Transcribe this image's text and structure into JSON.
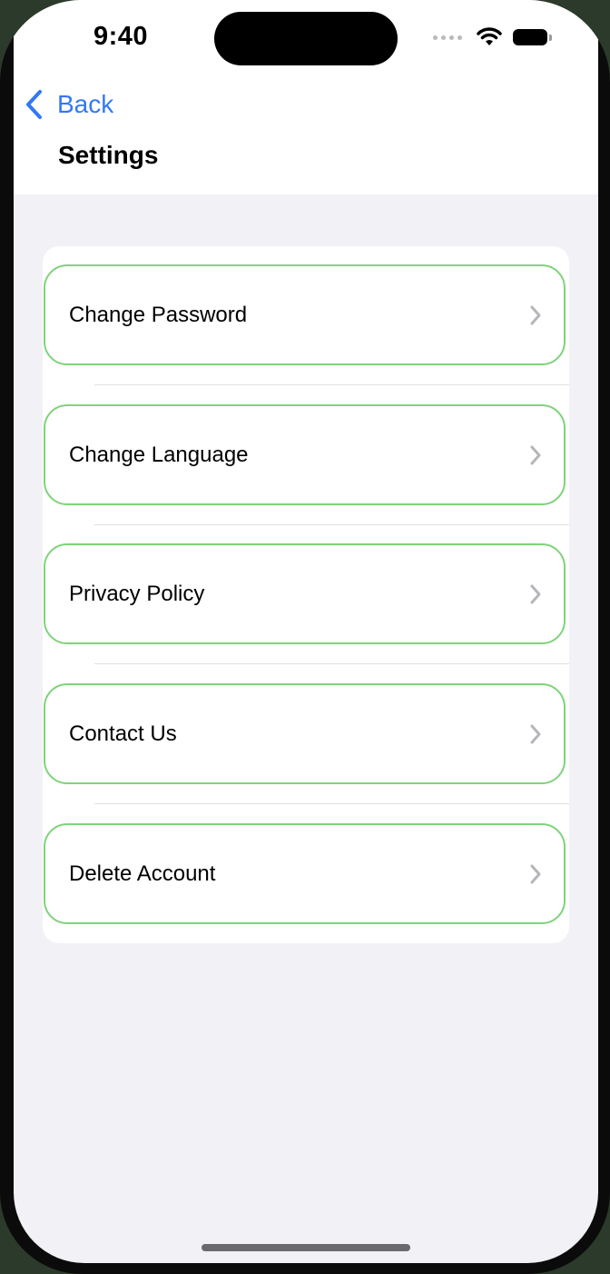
{
  "status_bar": {
    "time": "9:40"
  },
  "nav": {
    "back_label": "Back",
    "title": "Settings"
  },
  "menu": {
    "items": [
      {
        "label": "Change Password"
      },
      {
        "label": "Change Language"
      },
      {
        "label": "Privacy Policy"
      },
      {
        "label": "Contact Us"
      },
      {
        "label": "Delete Account"
      }
    ]
  },
  "colors": {
    "accent": "#3478f6",
    "row_border": "#7fd37a",
    "background": "#f1f1f6"
  },
  "icons": {
    "back": "chevron-left-icon",
    "row": "chevron-right-icon",
    "wifi": "wifi-icon",
    "battery": "battery-icon"
  }
}
